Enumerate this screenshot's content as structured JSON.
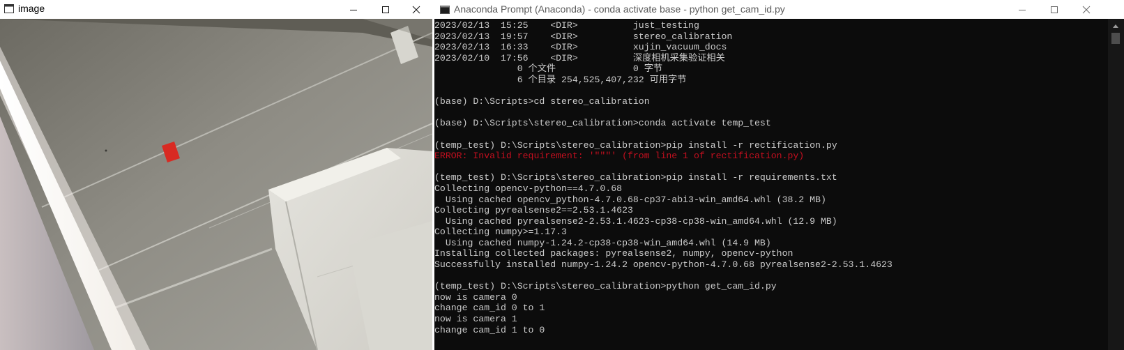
{
  "image_window": {
    "title": "image",
    "title_icon": "opencv-window-icon",
    "controls": [
      "minimize-icon",
      "maximize-icon",
      "close-icon"
    ]
  },
  "console_window": {
    "title": "Anaconda Prompt (Anaconda) - conda  activate base - python  get_cam_id.py",
    "title_icon": "console-icon",
    "controls": [
      "minimize-icon",
      "maximize-icon",
      "close-icon"
    ],
    "colors": {
      "background": "#0c0c0c",
      "text": "#cccccc",
      "error": "#c50f1f"
    },
    "lines": [
      {
        "text": "2023/02/13  15:25    <DIR>          just_testing",
        "error": false
      },
      {
        "text": "2023/02/13  19:57    <DIR>          stereo_calibration",
        "error": false
      },
      {
        "text": "2023/02/13  16:33    <DIR>          xujin_vacuum_docs",
        "error": false
      },
      {
        "text": "2023/02/10  17:56    <DIR>          深度相机采集验证相关",
        "error": false
      },
      {
        "text": "               0 个文件              0 字节",
        "error": false
      },
      {
        "text": "               6 个目录 254,525,407,232 可用字节",
        "error": false
      },
      {
        "text": "",
        "error": false
      },
      {
        "text": "(base) D:\\Scripts>cd stereo_calibration",
        "error": false
      },
      {
        "text": "",
        "error": false
      },
      {
        "text": "(base) D:\\Scripts\\stereo_calibration>conda activate temp_test",
        "error": false
      },
      {
        "text": "",
        "error": false
      },
      {
        "text": "(temp_test) D:\\Scripts\\stereo_calibration>pip install -r rectification.py",
        "error": false
      },
      {
        "text": "ERROR: Invalid requirement: '\"\"\"' (from line 1 of rectification.py)",
        "error": true
      },
      {
        "text": "",
        "error": false
      },
      {
        "text": "(temp_test) D:\\Scripts\\stereo_calibration>pip install -r requirements.txt",
        "error": false
      },
      {
        "text": "Collecting opencv-python==4.7.0.68",
        "error": false
      },
      {
        "text": "  Using cached opencv_python-4.7.0.68-cp37-abi3-win_amd64.whl (38.2 MB)",
        "error": false
      },
      {
        "text": "Collecting pyrealsense2==2.53.1.4623",
        "error": false
      },
      {
        "text": "  Using cached pyrealsense2-2.53.1.4623-cp38-cp38-win_amd64.whl (12.9 MB)",
        "error": false
      },
      {
        "text": "Collecting numpy>=1.17.3",
        "error": false
      },
      {
        "text": "  Using cached numpy-1.24.2-cp38-cp38-win_amd64.whl (14.9 MB)",
        "error": false
      },
      {
        "text": "Installing collected packages: pyrealsense2, numpy, opencv-python",
        "error": false
      },
      {
        "text": "Successfully installed numpy-1.24.2 opencv-python-4.7.0.68 pyrealsense2-2.53.1.4623",
        "error": false
      },
      {
        "text": "",
        "error": false
      },
      {
        "text": "(temp_test) D:\\Scripts\\stereo_calibration>python get_cam_id.py",
        "error": false
      },
      {
        "text": "now is camera 0",
        "error": false
      },
      {
        "text": "change cam_id 0 to 1",
        "error": false
      },
      {
        "text": "now is camera 1",
        "error": false
      },
      {
        "text": "change cam_id 1 to 0",
        "error": false
      }
    ]
  }
}
